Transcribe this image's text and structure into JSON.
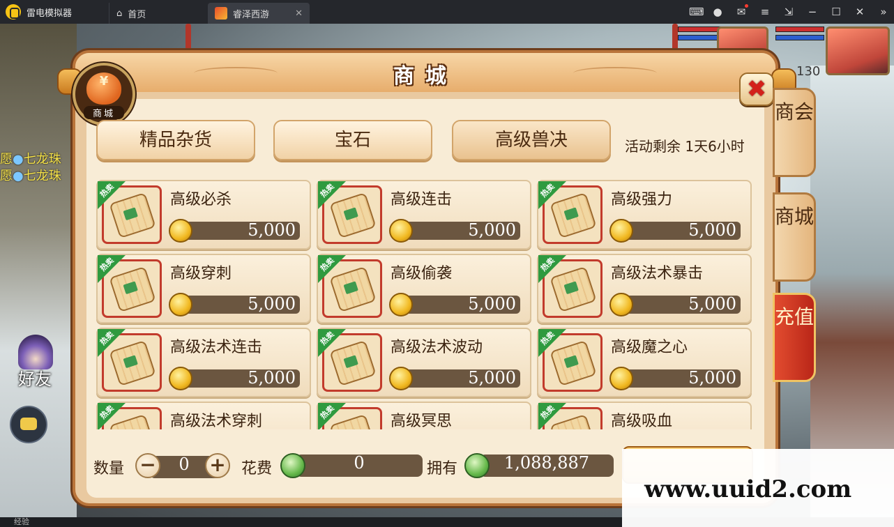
{
  "titlebar": {
    "app_name": "雷电模拟器",
    "tabs": [
      {
        "label": "首页",
        "icon": "home-icon"
      },
      {
        "label": "睿泽西游",
        "icon": "game-icon",
        "close": "✕"
      }
    ],
    "controls": [
      "gamepad-icon",
      "user-icon",
      "mail-icon",
      "menu-icon",
      "resize-icon",
      "minimize-icon",
      "maximize-icon",
      "close-icon",
      "collapse-icon"
    ]
  },
  "game_hud": {
    "chat_lines": [
      {
        "prefix": "愿",
        "dot": "●",
        "text": "七龙珠"
      },
      {
        "prefix": "愿",
        "dot": "●",
        "text": "七龙珠"
      }
    ],
    "friend_label": "好友",
    "level_number": "130",
    "exp_label": "经验"
  },
  "shop": {
    "emblem": {
      "symbol": "¥",
      "label": "商城"
    },
    "title": "商城",
    "close_symbol": "✖",
    "categories": [
      {
        "label": "精品杂货"
      },
      {
        "label": "宝石"
      },
      {
        "label": "高级兽决"
      }
    ],
    "event_timer": "活动剩余 1天6小时",
    "hot_badge": "热卖",
    "items": [
      {
        "name": "高级必杀",
        "price": "5,000"
      },
      {
        "name": "高级连击",
        "price": "5,000"
      },
      {
        "name": "高级强力",
        "price": "5,000"
      },
      {
        "name": "高级穿刺",
        "price": "5,000"
      },
      {
        "name": "高级偷袭",
        "price": "5,000"
      },
      {
        "name": "高级法术暴击",
        "price": "5,000"
      },
      {
        "name": "高级法术连击",
        "price": "5,000"
      },
      {
        "name": "高级法术波动",
        "price": "5,000"
      },
      {
        "name": "高级魔之心",
        "price": "5,000"
      },
      {
        "name": "高级法术穿刺",
        "price": ""
      },
      {
        "name": "高级冥思",
        "price": ""
      },
      {
        "name": "高级吸血",
        "price": ""
      }
    ],
    "footer": {
      "quantity_label": "数量",
      "minus": "−",
      "quantity": "0",
      "plus": "+",
      "cost_label": "花费",
      "cost": "0",
      "own_label": "拥有",
      "own": "1,088,887"
    },
    "side_tabs": [
      {
        "label": "商会"
      },
      {
        "label": "商城"
      },
      {
        "label": "充值"
      }
    ]
  },
  "watermark": "www.uuid2.com",
  "colors": {
    "panel": "#e9c9a0",
    "panel_border": "#b9743a",
    "price_bar": "#6b5640",
    "hot_badge": "#2f9a3f",
    "item_frame": "#c23b2c",
    "recharge_tab": "#d23a22"
  }
}
